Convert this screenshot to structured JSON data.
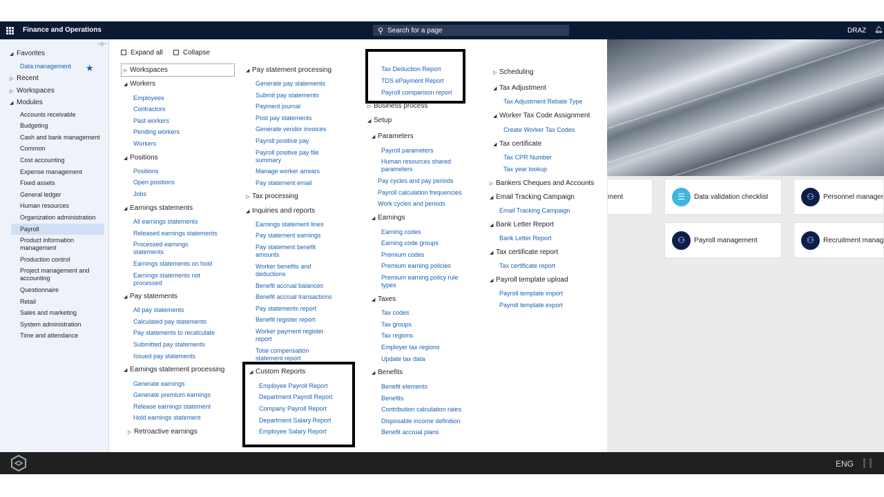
{
  "app": {
    "title": "Finance and Operations",
    "search_placeholder": "Search for a page",
    "company": "DRAZ"
  },
  "leftnav": {
    "favorites": "Favorites",
    "favorite_item": "Data management",
    "recent": "Recent",
    "workspaces": "Workspaces",
    "modules": "Modules",
    "modules_list": [
      "Accounts receivable",
      "Budgeting",
      "Cash and bank management",
      "Common",
      "Cost accounting",
      "Expense management",
      "Fixed assets",
      "General ledger",
      "Human resources",
      "Organization administration",
      "Payroll",
      "Product information management",
      "Production control",
      "Project management and accounting",
      "Questionnaire",
      "Retail",
      "Sales and marketing",
      "System administration",
      "Time and attendance"
    ],
    "selected": "Payroll"
  },
  "toolbar": {
    "expand_all": "Expand all",
    "collapse": "Collapse"
  },
  "col1": {
    "workspaces": "Workspaces",
    "workers": "Workers",
    "workers_links": [
      "Employees",
      "Contractors",
      "Past workers",
      "Pending workers",
      "Workers"
    ],
    "positions": "Positions",
    "positions_links": [
      "Positions",
      "Open positions",
      "Jobs"
    ],
    "earnings_statements": "Earnings statements",
    "earnings_links": [
      "All earnings statements",
      "Released earnings statements",
      "Processed earnings statements",
      "Earnings statements on hold",
      "Earnings statements not processed"
    ],
    "pay_statements": "Pay statements",
    "pay_links": [
      "All pay statements",
      "Calculated pay statements",
      "Pay statements to recalculate",
      "Submitted pay statements",
      "Issued pay statements"
    ],
    "earnings_processing": "Earnings statement processing",
    "earnings_processing_links": [
      "Generate earnings",
      "Generate premium earnings",
      "Release earnings statement",
      "Hold earnings statement"
    ],
    "retroactive": "Retroactive earnings"
  },
  "col2": {
    "pay_processing": "Pay statement processing",
    "pay_processing_links": [
      "Generate pay statements",
      "Submit pay statements",
      "Payment journal",
      "Post pay statements",
      "Generate vendor invoices",
      "Payroll positive pay",
      "Payroll positive pay file summary",
      "Manage worker arrears",
      "Pay statement email"
    ],
    "tax_processing": "Tax processing",
    "inquiries": "Inquiries and reports",
    "inquiries_links": [
      "Earnings statement lines",
      "Pay statement earnings",
      "Pay statement benefit amounts",
      "Worker benefits and deductions",
      "Benefit accrual balances",
      "Benefit accrual transactions",
      "Pay statements report",
      "Benefit register report",
      "Worker payment register report",
      "Total compensation statement report"
    ],
    "custom_reports": "Custom Reports",
    "custom_links": [
      "Employee Payroll Report",
      "Department Payroll Report",
      "Company Payroll Report",
      "Department Salary Report",
      "Employee Salary Report"
    ]
  },
  "col3": {
    "top_links": [
      "Tax Deduction Report",
      "TDS ePayment Report",
      "Payroll comparison report"
    ],
    "business_process": "Business process",
    "setup": "Setup",
    "parameters": "Parameters",
    "parameters_links": [
      "Payroll parameters",
      "Human resources shared parameters",
      "Pay cycles and pay periods",
      "Payroll calculation frequencies",
      "Work cycles and periods"
    ],
    "earnings": "Earnings",
    "earnings_links": [
      "Earning codes",
      "Earning code groups",
      "Premium codes",
      "Premium earning policies",
      "Premium earning policy rule types"
    ],
    "taxes": "Taxes",
    "taxes_links": [
      "Tax codes",
      "Tax groups",
      "Tax regions",
      "Employer tax regions",
      "Update tax data"
    ],
    "benefits": "Benefits",
    "benefits_links": [
      "Benefit elements",
      "Benefits",
      "Contribution calculation rates",
      "Disposable income definition",
      "Benefit accrual plans"
    ]
  },
  "col4": {
    "scheduling": "Scheduling",
    "tax_adjustment": "Tax Adjustment",
    "tax_adjustment_link": "Tax Adjustment Rebate Type",
    "worker_tax": "Worker Tax Code Assignment",
    "worker_tax_link": "Create Worker Tax Codes",
    "tax_certificate": "Tax certificate",
    "tax_certificate_links": [
      "Tax CPR Number",
      "Tax year lookup"
    ],
    "bankers": "Bankers Cheques and Accounts",
    "email_tracking": "Email Tracking Campaign",
    "email_tracking_link": "Email Tracking Campaign",
    "bank_letter": "Bank Letter Report",
    "bank_letter_link": "Bank Letter Report",
    "tax_cert_report": "Tax certificate report",
    "tax_cert_report_link": "Tax certificate report",
    "template_upload": "Payroll template upload",
    "template_links": [
      "Payroll template import",
      "Payroll template export"
    ]
  },
  "tiles": {
    "partial": "ment",
    "data_validation": "Data validation checklist",
    "personnel": "Personnel manageme",
    "payroll_mgmt": "Payroll management",
    "recruitment": "Recruitment manage"
  },
  "taskbar": {
    "lang": "ENG"
  }
}
